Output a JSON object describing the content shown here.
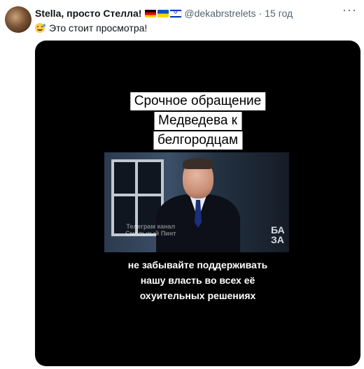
{
  "post": {
    "author_name": "Stella, просто Стелла!",
    "handle": "@dekabrstrelets",
    "separator": "·",
    "time": "15 год",
    "more_label": "···",
    "text": "Это стоит просмотра!",
    "emoji": "sweat-smile-emoji",
    "flags": [
      "flag-germany",
      "flag-ukraine",
      "flag-israel"
    ]
  },
  "media": {
    "caption_lines": [
      "Срочное обращение",
      "Медведева к",
      "белгородцам"
    ],
    "watermark_lines": [
      "Телеграм канал",
      "Смольный Пинт"
    ],
    "logo_lines": [
      "БА",
      "ЗА"
    ],
    "subtitle_lines": [
      "не забывайте поддерживать",
      "нашу власть во всех её",
      "охуительных решениях"
    ]
  }
}
